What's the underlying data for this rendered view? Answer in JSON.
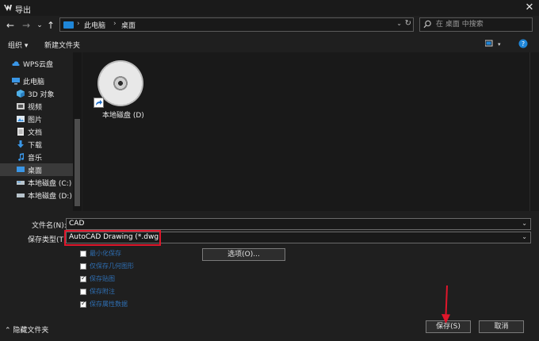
{
  "window": {
    "title": "导出",
    "close_glyph": "✕"
  },
  "nav": {
    "back": "←",
    "forward": "→",
    "dropdown": "⌄",
    "up": "↑"
  },
  "address": {
    "sep": "›",
    "crumbs": [
      "此电脑",
      "桌面"
    ],
    "dropdown": "⌄",
    "refresh": "↻"
  },
  "search": {
    "placeholder": "在 桌面 中搜索",
    "value": ""
  },
  "toolbar": {
    "organize": "组织 ▾",
    "new_folder": "新建文件夹",
    "help": "?"
  },
  "sidebar": {
    "items": [
      {
        "label": "WPS云盘",
        "icon": "cloud-icon"
      },
      {
        "label": "此电脑",
        "icon": "computer-icon"
      },
      {
        "label": "3D 对象",
        "icon": "cube-icon"
      },
      {
        "label": "视频",
        "icon": "video-icon"
      },
      {
        "label": "图片",
        "icon": "picture-icon"
      },
      {
        "label": "文档",
        "icon": "document-icon"
      },
      {
        "label": "下载",
        "icon": "download-icon"
      },
      {
        "label": "音乐",
        "icon": "music-icon"
      },
      {
        "label": "桌面",
        "icon": "desktop-icon",
        "active": true
      },
      {
        "label": "本地磁盘 (C:)",
        "icon": "drive-icon"
      },
      {
        "label": "本地磁盘 (D:)",
        "icon": "drive-icon"
      }
    ]
  },
  "content": {
    "items": [
      {
        "label": "本地磁盘 (D)",
        "icon": "disc-drive-icon"
      }
    ]
  },
  "form": {
    "filename_label": "文件名(N):",
    "filename_value": "CAD",
    "filetype_label": "保存类型(T):",
    "filetype_value": "AutoCAD Drawing (*.dwg)",
    "drop": "⌄",
    "options_label": "选项(O)...",
    "checkboxes": [
      {
        "label": "最小化保存",
        "checked": false
      },
      {
        "label": "仅保存几何图形",
        "checked": false
      },
      {
        "label": "保存贴图",
        "checked": true
      },
      {
        "label": "保存附注",
        "checked": false
      },
      {
        "label": "保存属性数据",
        "checked": true
      }
    ]
  },
  "footer": {
    "hide_folders": "⌃ 隐藏文件夹",
    "save": "保存(S)",
    "cancel": "取消"
  },
  "colors": {
    "background": "#1f1f1f",
    "highlight_red": "#e0162b",
    "accent_blue": "#1f86d8"
  }
}
